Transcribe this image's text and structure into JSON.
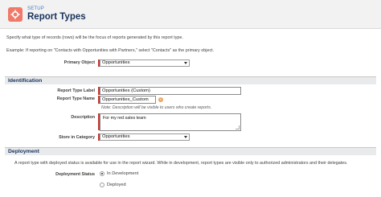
{
  "header": {
    "eyebrow": "SETUP",
    "title": "Report Types",
    "icon": "setup-gear-icon",
    "icon_color": "#ef7a6a"
  },
  "intro": {
    "text": "Specify what type of records (rows) will be the focus of reports generated by this report type.",
    "example": "Example: If reporting on \"Contacts with Opportunities with Partners,\" select \"Contacts\" as the primary object."
  },
  "primary_object": {
    "label": "Primary Object",
    "value": "Opportunities"
  },
  "identification": {
    "heading": "Identification",
    "report_type_label": {
      "label": "Report Type Label",
      "value": "Opportunities (Custom)"
    },
    "report_type_name": {
      "label": "Report Type Name",
      "value": "Opportunities_Custom"
    },
    "description": {
      "label": "Description",
      "note": "Note: Description will be visible to users who create reports.",
      "value": "For my red sales team"
    },
    "store_in_category": {
      "label": "Store in Category",
      "value": "Opportunities"
    }
  },
  "deployment": {
    "heading": "Deployment",
    "text": "A report type with deployed status is available for use in the report wizard. While in development, report types are visible only to authorized administrators and their delegates.",
    "status_label": "Deployment Status",
    "options": [
      {
        "label": "In Development",
        "checked": true
      },
      {
        "label": "Deployed",
        "checked": false
      }
    ]
  }
}
